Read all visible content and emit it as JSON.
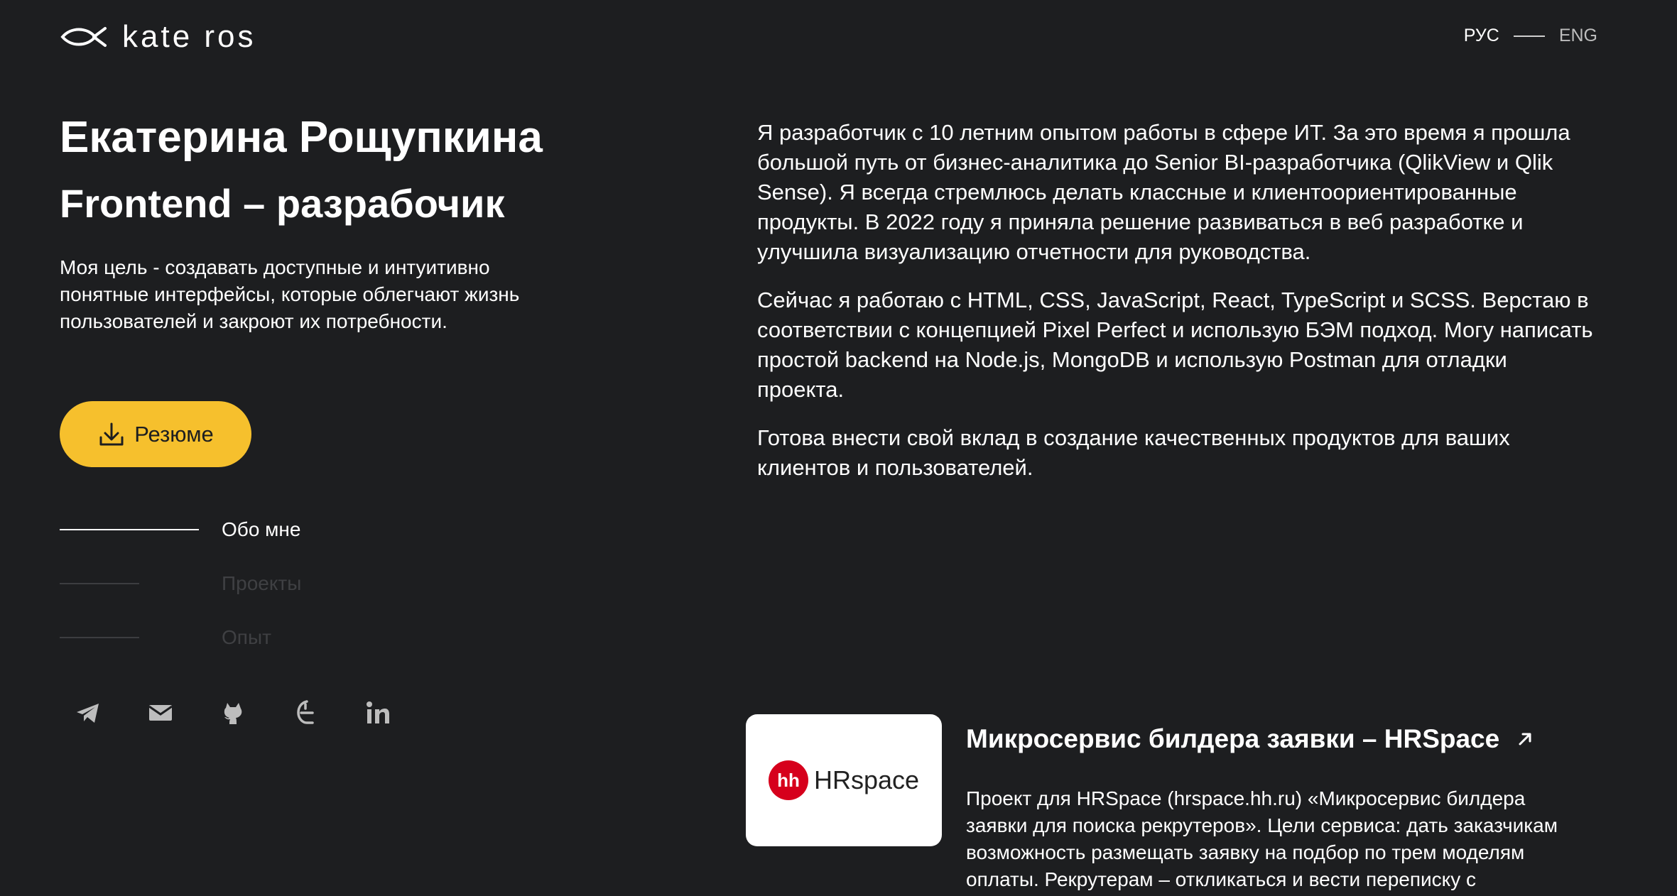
{
  "header": {
    "logo_text": "kate ros",
    "lang_ru": "РУС",
    "lang_en": "ENG"
  },
  "hero": {
    "name": "Екатерина Рощупкина",
    "role": "Frontend – разрабочик",
    "goal": "Моя цель - создавать доступные и интуитивно понятные интерфейсы, которые облегчают жизнь пользователей и закроют их потребности.",
    "resume_label": "Резюме"
  },
  "nav": {
    "items": [
      {
        "label": "Обо мне",
        "active": true
      },
      {
        "label": "Проекты",
        "active": false
      },
      {
        "label": "Опыт",
        "active": false
      }
    ]
  },
  "socials": [
    "telegram-icon",
    "mail-icon",
    "github-icon",
    "habr-icon",
    "linkedin-icon"
  ],
  "about": {
    "paragraphs": [
      "Я разработчик с 10 летним опытом работы в сфере ИТ. За это время я прошла большой путь от бизнес-аналитика до Senior BI-разработчика (QlikView и Qlik Sense). Я всегда стремлюсь делать классные и клиентоориентированные продукты. В 2022 году я приняла решение развиваться в веб разработке и улучшила визуализацию отчетности для руководства.",
      "Сейчас я работаю с HTML, CSS, JavaScript, React, TypeScript и SCSS. Верстаю в соответствии с концепцией Pixel Perfect и использую БЭМ подход. Могу написать простой backend на Node.js, MongoDB и использую Postman для отладки проекта.",
      "Готова внести свой вклад в создание качественных продуктов для ваших клиентов и пользователей."
    ]
  },
  "project": {
    "logo_badge": "hh",
    "logo_word": "HRspace",
    "title": "Микросервис билдера заявки – HRSpace",
    "description": "Проект для HRSpace (hrspace.hh.ru) «Микросервис билдера заявки для поиска рекрутеров». Цели сервиса: дать заказчикам возможность размещать заявку на подбор по трем моделям оплаты. Рекрутерам – откликаться и вести переписку с"
  },
  "colors": {
    "background": "#1d1e20",
    "accent": "#f6c02d",
    "muted": "#3f4043"
  }
}
